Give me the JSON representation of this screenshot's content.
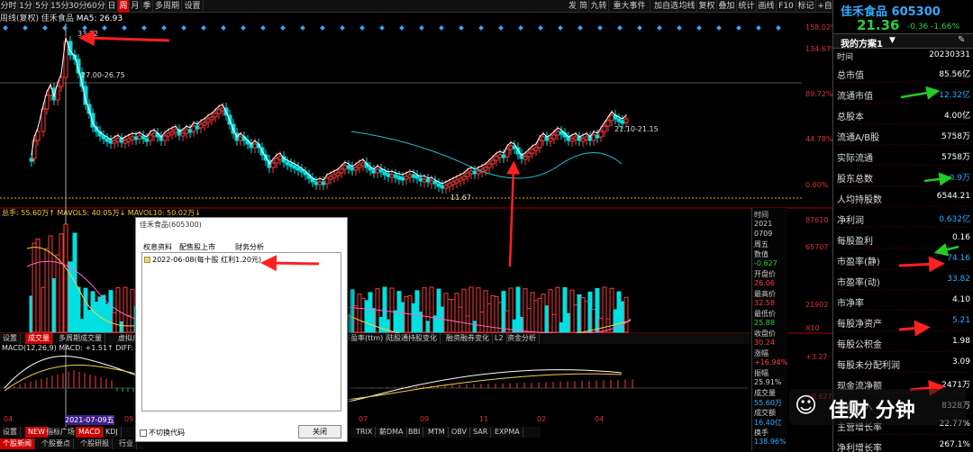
{
  "toolbar": {
    "items": [
      "分时",
      "1分",
      "5分",
      "15分",
      "30分",
      "60分",
      "日",
      "周",
      "月",
      "季",
      "多周期",
      "设置"
    ],
    "selected": "周",
    "right_items": [
      "发",
      "简",
      "九转",
      "重大事件",
      "加自选",
      "均线",
      "复权",
      "叠加",
      "统计",
      "画线",
      "F10",
      "标记",
      "+自",
      "返回"
    ]
  },
  "chart_header": {
    "mode": "周线(复权)",
    "stock": "佳禾食品",
    "ma5": "MA5: 26.93"
  },
  "main_chart": {
    "pct_labels": [
      "158.02%",
      "134.67%",
      "89.72%",
      "44.78%",
      "0.00%"
    ],
    "annotations": {
      "high": "33.32",
      "range1": "27.00-26.75",
      "range2": "21.10-21.15",
      "low": "11.67"
    },
    "accent_red": "#ff2020",
    "cyan": "#00e0e0"
  },
  "volume": {
    "header": "总手: 55.60万↑ MAVOL5: 40.05万↓ MAVOL10: 50.02万↓",
    "right_labels": [
      "87610",
      "65707",
      "21902",
      "X10"
    ],
    "tabs": [
      "设置",
      "成交量",
      "多周期成交量",
      "虚拟成交量",
      "市盈率(ttm)",
      "陆股通持股变化",
      "融资融券变化",
      "L2",
      "资金分析"
    ]
  },
  "macd": {
    "header": "MACD(12,26,9) MACD: +1.51↑ DIFF: +3.1",
    "right_labels": [
      "+3.27",
      "+0.627"
    ]
  },
  "x_axis": [
    "04",
    "2021-07-09五",
    "09",
    "07",
    "09",
    "11",
    "02",
    "04"
  ],
  "bottom_tabs": [
    "设置",
    "NEW",
    "指标广场",
    "MACD",
    "KDJ",
    "TRIX",
    "薪DMA",
    "BBI",
    "MTM",
    "OBV",
    "SAR",
    "EXPMA"
  ],
  "bottom_tabs2": [
    "个股新闻",
    "个股要点",
    "个股研报",
    "行业"
  ],
  "crosshair": {
    "time_label": "时间",
    "year": "2021",
    "date": "0709",
    "weekday": "周五",
    "value_label": "数值",
    "value": "-0.627",
    "open_label": "开盘价",
    "open": "26.06",
    "high_label": "最高价",
    "high": "32.58",
    "low_label": "最低价",
    "low": "25.88",
    "close_label": "收盘价",
    "close": "30.24",
    "chg_label": "涨幅",
    "chg": "+16.94%",
    "amp_label": "振幅",
    "amp": "25.91%",
    "vol_label": "成交量",
    "vol": "55.60万",
    "amt_label": "成交额",
    "amt": "16.40亿",
    "turn_label": "换手",
    "turn": "138.96%"
  },
  "quote": {
    "name": "佳禾食品",
    "code": "605300",
    "price": "21.36",
    "change": "-0.36",
    "pct": "-1.66%"
  },
  "plan": {
    "title": "我的方案1",
    "time_label": "时间",
    "time": "20230331"
  },
  "fundamentals": [
    {
      "k": "总市值",
      "v": "85.56亿"
    },
    {
      "k": "流通市值",
      "v": "12.32亿"
    },
    {
      "k": "总股本",
      "v": "4.00亿"
    },
    {
      "k": "流通A/B股",
      "v": "5758万"
    },
    {
      "k": "实际流通",
      "v": "5758万"
    },
    {
      "k": "股东总数",
      "v": "0.9万"
    },
    {
      "k": "人均持股数",
      "v": "6544.21"
    },
    {
      "k": "净利润",
      "v": "0.632亿"
    },
    {
      "k": "每股盈利",
      "v": "0.16"
    },
    {
      "k": "市盈率(静)",
      "v": "74.16"
    },
    {
      "k": "市盈率(动)",
      "v": "33.82"
    },
    {
      "k": "市净率",
      "v": "4.10"
    },
    {
      "k": "每股净资产",
      "v": "5.21"
    },
    {
      "k": "每股公积金",
      "v": "1.98"
    },
    {
      "k": "每股未分配利润",
      "v": "3.09"
    },
    {
      "k": "现金流净额",
      "v": "2471万"
    },
    {
      "k": "营业收入",
      "v": "8328万"
    },
    {
      "k": "主营增长率",
      "v": "22.77%"
    },
    {
      "k": "净利增长率",
      "v": "267.1%"
    }
  ],
  "dialog": {
    "title": "佳禾食品(605300)",
    "tabs": [
      "权息资料",
      "配售股上市",
      "财务分析"
    ],
    "item": "2022-06-08(每十股 红利1.20元)",
    "checkbox": "不切换代码",
    "close": "关闭"
  },
  "watermark": {
    "text": "佳财 分钟"
  }
}
